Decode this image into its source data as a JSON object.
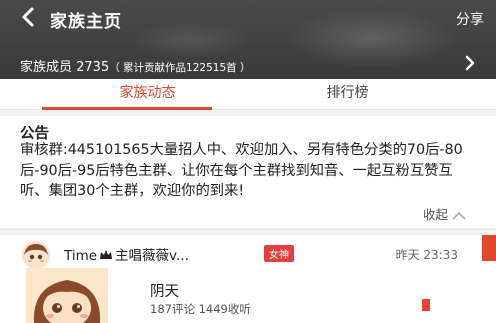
{
  "header": {
    "title": "家族主页",
    "share_label": "分享"
  },
  "family": {
    "members_label": "家族成员 2735",
    "contribution_label": "（ 累计贡献作品122515首 ）"
  },
  "tabs": [
    {
      "label": "家族动态",
      "active": true
    },
    {
      "label": "排行榜",
      "active": false
    }
  ],
  "notice": {
    "title": "公告",
    "body": "审核群:445101565大量招人中、欢迎加入、另有特色分类的70后-80后-90后-95后特色主群、让你在每个主群找到知音、一起互粉互赞互听、集团30个主群，欢迎你的到来!",
    "collapse_label": "收起"
  },
  "post": {
    "user_prefix": "Time",
    "user_suffix": "主唱薇薇v...",
    "badge": "女神",
    "time": "昨天 23:33",
    "song_title": "阴天",
    "stats": "187评论 1449收听"
  },
  "colors": {
    "accent": "#e0472e",
    "header_bg": "#3e3e3e"
  },
  "icons": {
    "back": "chevron-left-icon",
    "members": "chevron-right-icon",
    "collapse": "chevron-up-icon",
    "crown": "crown-icon"
  }
}
